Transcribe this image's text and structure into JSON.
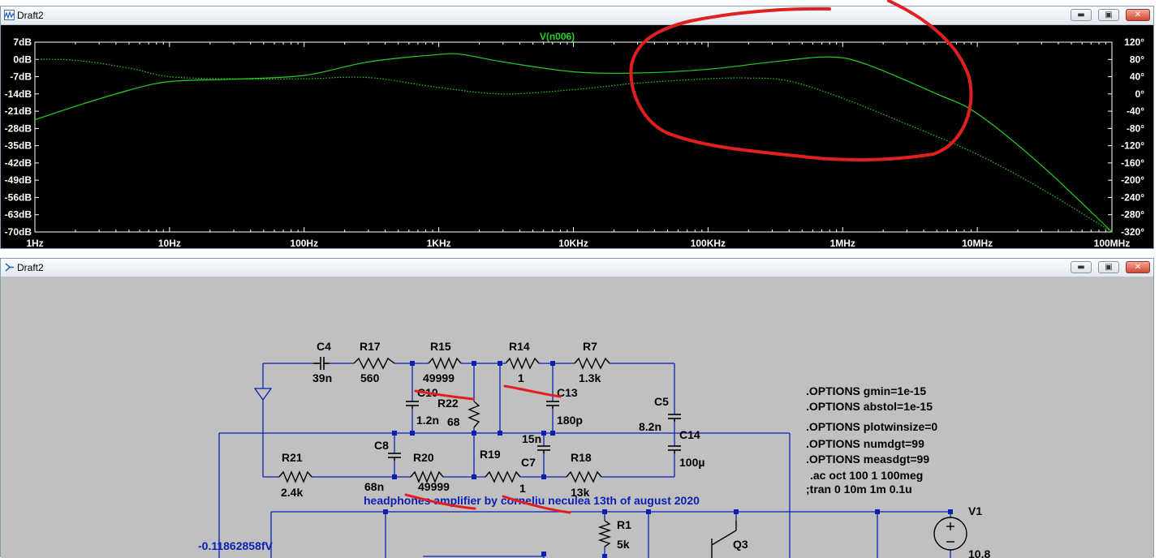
{
  "plot_window": {
    "title": "Draft2",
    "trace_name": "V(n006)",
    "buttons": {
      "minimize": "▬",
      "maximize": "▣",
      "close": "✕"
    }
  },
  "schematic_window": {
    "title": "Draft2",
    "buttons": {
      "minimize": "▬",
      "maximize": "▣",
      "close": "✕"
    }
  },
  "chart_data": {
    "type": "line",
    "title": "V(n006)",
    "x_scale": "log",
    "x_range_hz": [
      1,
      100000000
    ],
    "x_ticks": [
      "1Hz",
      "10Hz",
      "100Hz",
      "1KHz",
      "10KHz",
      "100KHz",
      "1MHz",
      "10MHz",
      "100MHz"
    ],
    "y_left_ticks": [
      "7dB",
      "0dB",
      "-7dB",
      "-14dB",
      "-21dB",
      "-28dB",
      "-35dB",
      "-42dB",
      "-49dB",
      "-56dB",
      "-63dB",
      "-70dB"
    ],
    "y_left_range_db": [
      -70,
      7
    ],
    "y_right_ticks": [
      "120°",
      "80°",
      "40°",
      "0°",
      "-40°",
      "-80°",
      "-120°",
      "-160°",
      "-200°",
      "-240°",
      "-280°",
      "-320°"
    ],
    "y_right_range_deg": [
      -320,
      120
    ],
    "colors": {
      "trace": "#22d022",
      "background": "#000000",
      "axis": "#ffffff"
    },
    "series": [
      {
        "style": "solid",
        "axis": "left",
        "x": [
          1,
          2,
          5,
          10,
          30,
          100,
          300,
          1000,
          1500,
          3000,
          10000,
          30000,
          100000,
          300000,
          800000,
          1500000,
          5000000,
          10000000,
          30000000,
          100000000
        ],
        "y": [
          -24.5,
          -19,
          -12.5,
          -9,
          -8,
          -6.5,
          -1,
          2,
          2,
          -1,
          -5,
          -5.5,
          -4,
          -1,
          1,
          -2,
          -14,
          -22,
          -43,
          -70
        ]
      },
      {
        "style": "dotted",
        "axis": "right",
        "x": [
          1,
          2,
          5,
          10,
          30,
          100,
          300,
          1000,
          3000,
          10000,
          30000,
          100000,
          200000,
          400000,
          1000000,
          3000000,
          10000000,
          30000000,
          100000000
        ],
        "y": [
          80,
          78,
          60,
          40,
          35,
          35,
          38,
          15,
          0,
          10,
          25,
          35,
          37,
          30,
          -10,
          -70,
          -140,
          -220,
          -320
        ]
      }
    ]
  },
  "schematic": {
    "components": [
      {
        "ref": "C4",
        "value": "39n"
      },
      {
        "ref": "R17",
        "value": "560"
      },
      {
        "ref": "R15",
        "value": "49999"
      },
      {
        "ref": "R14",
        "value": "1"
      },
      {
        "ref": "R7",
        "value": "1.3k"
      },
      {
        "ref": "C10",
        "value": "1.2n"
      },
      {
        "ref": "R22",
        "value": "68"
      },
      {
        "ref": "C13",
        "value": "180p"
      },
      {
        "ref": "C5",
        "value": "8.2n"
      },
      {
        "ref": "C14",
        "value": "100µ"
      },
      {
        "ref": "C8",
        "value": "68n"
      },
      {
        "ref": "R21",
        "value": "2.4k"
      },
      {
        "ref": "R20",
        "value": "49999"
      },
      {
        "ref": "R19",
        "value": "1"
      },
      {
        "ref": "C7",
        "value": "15n"
      },
      {
        "ref": "R18",
        "value": "13k"
      },
      {
        "ref": "R1",
        "value": "5k"
      },
      {
        "ref": "Q3",
        "value": ""
      },
      {
        "ref": "V1",
        "value": "10.8"
      }
    ],
    "directives": [
      ".OPTIONS gmin=1e-15",
      ".OPTIONS abstol=1e-15",
      ".OPTIONS plotwinsize=0",
      ".OPTIONS numdgt=99",
      ".OPTIONS measdgt=99",
      ".ac oct 100 1 100meg",
      ";tran 0 10m 1m 0.1u"
    ],
    "comment": "headphones amplifier by corneliu neculea 13th of august 2020",
    "probe_value": "-0.11862858fV",
    "colors": {
      "wire": "#0a1fb4",
      "component": "#000000",
      "background": "#c0c0c0"
    }
  }
}
